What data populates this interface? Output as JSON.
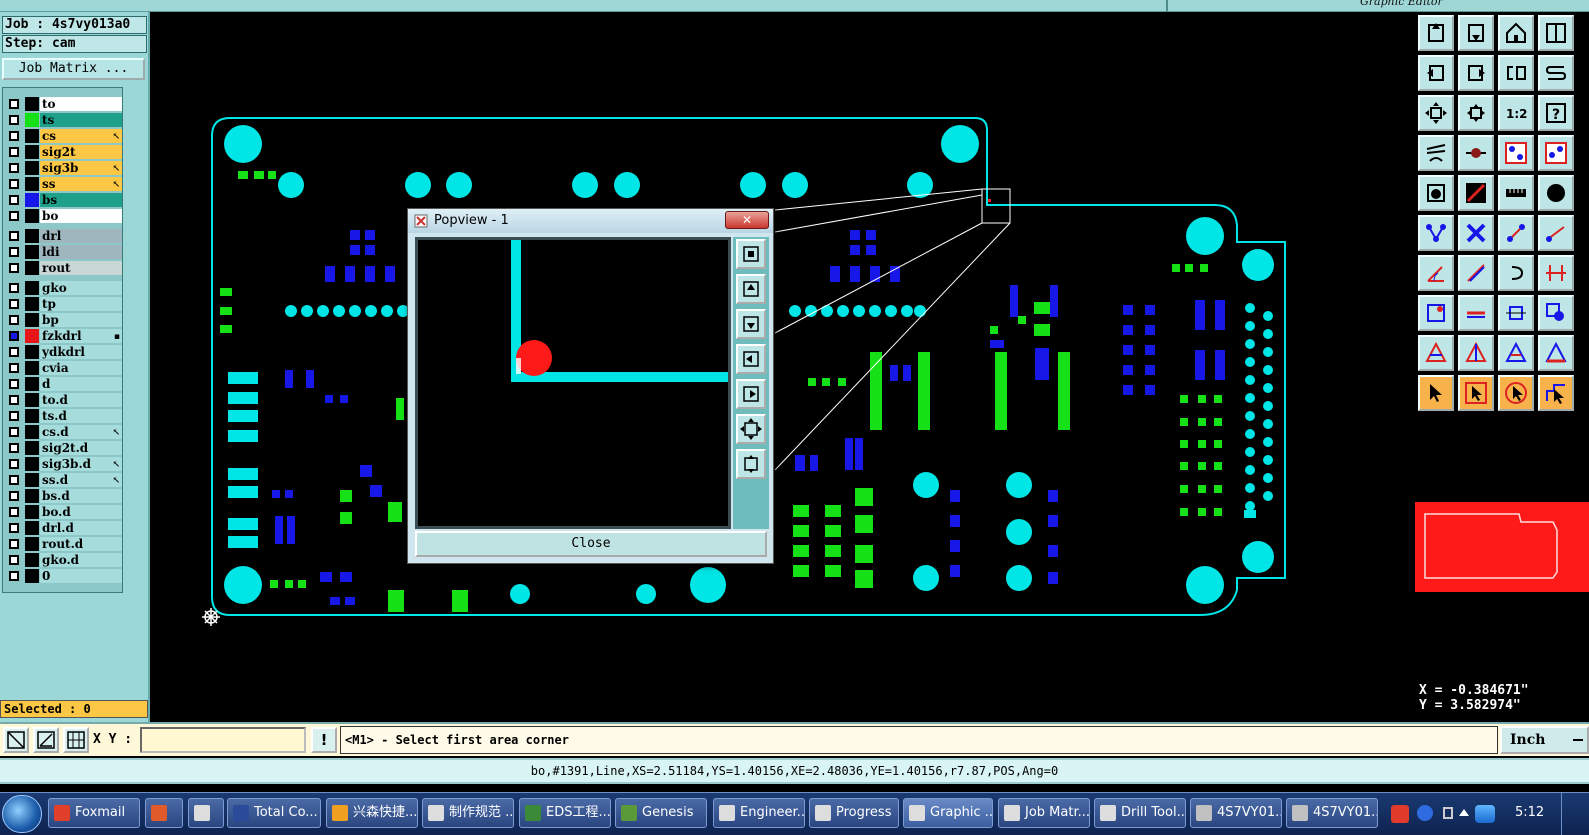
{
  "window": {
    "title": "Graphic Editor"
  },
  "job": {
    "label": "Job : 4s7vy013a0",
    "step": "Step: cam",
    "matrix_button": "Job Matrix ..."
  },
  "layers": [
    {
      "name": "to",
      "color": "#ffffff",
      "swatch": "#000000",
      "marker": ""
    },
    {
      "name": "ts",
      "color": "#1ea08a",
      "swatch": "#16e016",
      "marker": ""
    },
    {
      "name": "cs",
      "color": "#fcc744",
      "swatch": "#000000",
      "marker": "↖"
    },
    {
      "name": "sig2t",
      "color": "#fcc744",
      "swatch": "#000000",
      "marker": ""
    },
    {
      "name": "sig3b",
      "color": "#fcc744",
      "swatch": "#000000",
      "marker": "↖"
    },
    {
      "name": "ss",
      "color": "#fcc744",
      "swatch": "#000000",
      "marker": "↖"
    },
    {
      "name": "bs",
      "color": "#1ea08a",
      "swatch": "#1717e8",
      "marker": ""
    },
    {
      "name": "bo",
      "color": "#ffffff",
      "swatch": "#000000",
      "marker": ""
    },
    {
      "name": "drl",
      "color": "#9fb6bf",
      "swatch": "#000000",
      "marker": ""
    },
    {
      "name": "ldi",
      "color": "#9fb6bf",
      "swatch": "#000000",
      "marker": ""
    },
    {
      "name": "rout",
      "color": "#c8d6d6",
      "swatch": "#000000",
      "marker": ""
    },
    {
      "name": "gko",
      "color": "#a7dcdc",
      "swatch": "#000000",
      "marker": ""
    },
    {
      "name": "tp",
      "color": "#a7dcdc",
      "swatch": "#000000",
      "marker": ""
    },
    {
      "name": "bp",
      "color": "#a7dcdc",
      "swatch": "#000000",
      "marker": ""
    },
    {
      "name": "fzkdrl",
      "color": "#a7dcdc",
      "swatch": "#e81717",
      "marker": "▪"
    },
    {
      "name": "ydkdrl",
      "color": "#a7dcdc",
      "swatch": "#000000",
      "marker": ""
    },
    {
      "name": "cvia",
      "color": "#a7dcdc",
      "swatch": "#000000",
      "marker": ""
    },
    {
      "name": "d",
      "color": "#a7dcdc",
      "swatch": "#000000",
      "marker": ""
    },
    {
      "name": "to.d",
      "color": "#a7dcdc",
      "swatch": "#000000",
      "marker": ""
    },
    {
      "name": "ts.d",
      "color": "#a7dcdc",
      "swatch": "#000000",
      "marker": ""
    },
    {
      "name": "cs.d",
      "color": "#a7dcdc",
      "swatch": "#000000",
      "marker": "↖"
    },
    {
      "name": "sig2t.d",
      "color": "#a7dcdc",
      "swatch": "#000000",
      "marker": ""
    },
    {
      "name": "sig3b.d",
      "color": "#a7dcdc",
      "swatch": "#000000",
      "marker": "↖"
    },
    {
      "name": "ss.d",
      "color": "#a7dcdc",
      "swatch": "#000000",
      "marker": "↖"
    },
    {
      "name": "bs.d",
      "color": "#a7dcdc",
      "swatch": "#000000",
      "marker": ""
    },
    {
      "name": "bo.d",
      "color": "#a7dcdc",
      "swatch": "#000000",
      "marker": ""
    },
    {
      "name": "drl.d",
      "color": "#a7dcdc",
      "swatch": "#000000",
      "marker": ""
    },
    {
      "name": "rout.d",
      "color": "#a7dcdc",
      "swatch": "#000000",
      "marker": ""
    },
    {
      "name": "gko.d",
      "color": "#a7dcdc",
      "swatch": "#000000",
      "marker": ""
    },
    {
      "name": "0",
      "color": "#a7dcdc",
      "swatch": "#000000",
      "marker": ""
    }
  ],
  "selected": "Selected : 0",
  "popview": {
    "title": "Popview - 1",
    "close_x": "✕",
    "close_button": "Close"
  },
  "coords": {
    "x": "X = -0.384671\"",
    "y": "Y = 3.582974\""
  },
  "command": {
    "xy_label": "X Y :",
    "xy_value": "",
    "info_icon": "!",
    "prompt": "<M1> - Select first area corner",
    "units": "Inch"
  },
  "status": "bo,#1391,Line,XS=2.51184,YS=1.40156,XE=2.48036,YE=1.40156,r7.87,POS,Ang=0",
  "taskbar": {
    "items": [
      "Foxmail",
      "",
      "",
      "Total Co...",
      "兴森快捷...",
      "制作规范 ...",
      "EDS工程...",
      "Genesis",
      "Engineer...",
      "Progress",
      "Graphic ...",
      "Job Matr...",
      "Drill Tool...",
      "4S7VY01...",
      "4S7VY01..."
    ],
    "clock": "5:12"
  },
  "colors": {
    "accent": "#00e5e5",
    "panel": "#9cd7d7",
    "highlight": "#fcc744",
    "blue": "#1717e8",
    "green": "#16e016",
    "red": "#ff1a1a"
  }
}
